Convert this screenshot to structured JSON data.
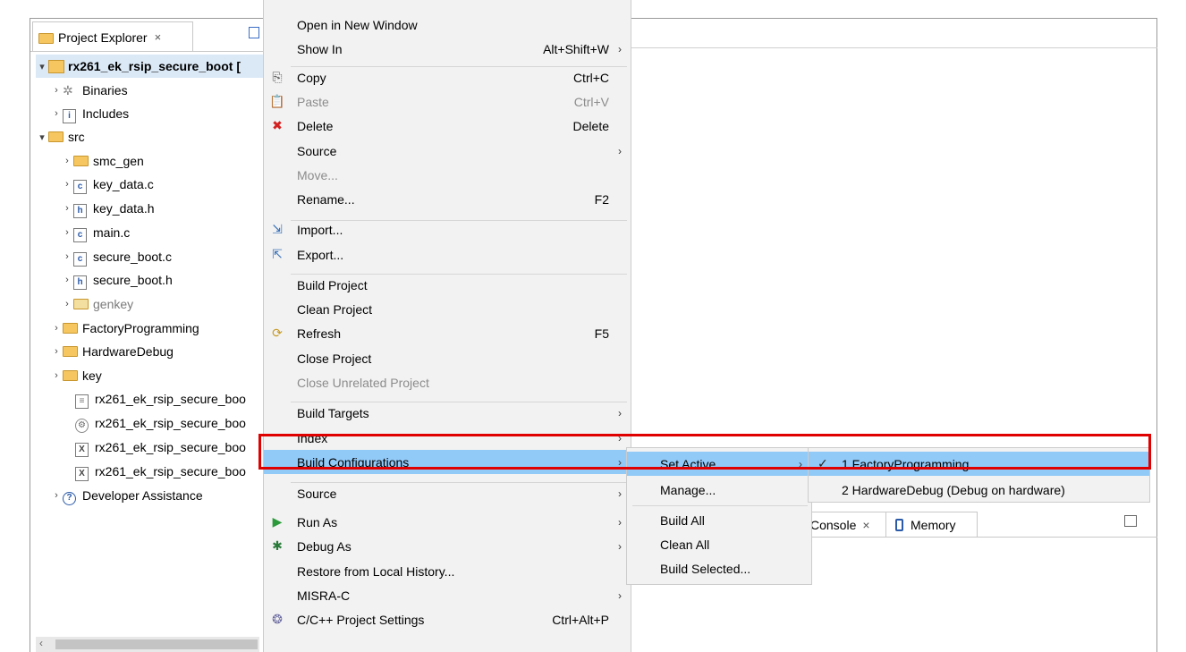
{
  "explorer": {
    "tab_label": "Project Explorer",
    "tab_close": "×",
    "items": [
      {
        "label": "rx261_ek_rsip_secure_boot [",
        "chevron": "▾",
        "icon": "project-icon"
      },
      {
        "label": "Binaries",
        "chevron": "›",
        "icon": "binaries-icon"
      },
      {
        "label": "Includes",
        "chevron": "›",
        "icon": "includes-icon"
      },
      {
        "label": "src",
        "chevron": "▾",
        "icon": "source-folder-icon"
      },
      {
        "label": "smc_gen",
        "chevron": "›",
        "icon": "folder-icon"
      },
      {
        "label": "key_data.c",
        "chevron": "›",
        "icon": "c-file-icon"
      },
      {
        "label": "key_data.h",
        "chevron": "›",
        "icon": "h-file-icon"
      },
      {
        "label": "main.c",
        "chevron": "›",
        "icon": "c-file-icon"
      },
      {
        "label": "secure_boot.c",
        "chevron": "›",
        "icon": "c-file-icon"
      },
      {
        "label": "secure_boot.h",
        "chevron": "›",
        "icon": "h-file-icon"
      },
      {
        "label": "genkey",
        "chevron": "›",
        "icon": "excluded-folder-icon"
      },
      {
        "label": "FactoryProgramming",
        "chevron": "›",
        "icon": "folder-icon"
      },
      {
        "label": "HardwareDebug",
        "chevron": "›",
        "icon": "folder-icon"
      },
      {
        "label": "key",
        "chevron": "›",
        "icon": "folder-icon"
      },
      {
        "label": "rx261_ek_rsip_secure_boo",
        "chevron": "",
        "icon": "document-icon"
      },
      {
        "label": "rx261_ek_rsip_secure_boo",
        "chevron": "",
        "icon": "gear-file-icon"
      },
      {
        "label": "rx261_ek_rsip_secure_boo",
        "chevron": "",
        "icon": "xml-file-icon"
      },
      {
        "label": "rx261_ek_rsip_secure_boo",
        "chevron": "",
        "icon": "xml-file-icon"
      },
      {
        "label": "Developer Assistance",
        "chevron": "›",
        "icon": "help-icon"
      }
    ],
    "scroll_left": "‹"
  },
  "context_menu": {
    "items": [
      {
        "label": "Open in New Window",
        "accel": "",
        "sub": false,
        "disabled": false
      },
      {
        "label": "Show In",
        "accel": "Alt+Shift+W",
        "sub": true,
        "disabled": false
      },
      {
        "label": "Copy",
        "accel": "Ctrl+C",
        "sub": false,
        "disabled": false
      },
      {
        "label": "Paste",
        "accel": "Ctrl+V",
        "sub": false,
        "disabled": true
      },
      {
        "label": "Delete",
        "accel": "Delete",
        "sub": false,
        "disabled": false
      },
      {
        "label": "Source",
        "accel": "",
        "sub": true,
        "disabled": false
      },
      {
        "label": "Move...",
        "accel": "",
        "sub": false,
        "disabled": true
      },
      {
        "label": "Rename...",
        "accel": "F2",
        "sub": false,
        "disabled": false
      },
      {
        "label": "Import...",
        "accel": "",
        "sub": false,
        "disabled": false
      },
      {
        "label": "Export...",
        "accel": "",
        "sub": false,
        "disabled": false
      },
      {
        "label": "Build Project",
        "accel": "",
        "sub": false,
        "disabled": false
      },
      {
        "label": "Clean Project",
        "accel": "",
        "sub": false,
        "disabled": false
      },
      {
        "label": "Refresh",
        "accel": "F5",
        "sub": false,
        "disabled": false
      },
      {
        "label": "Close Project",
        "accel": "",
        "sub": false,
        "disabled": false
      },
      {
        "label": "Close Unrelated Project",
        "accel": "",
        "sub": false,
        "disabled": true
      },
      {
        "label": "Build Targets",
        "accel": "",
        "sub": true,
        "disabled": false
      },
      {
        "label": "Index",
        "accel": "",
        "sub": true,
        "disabled": false
      },
      {
        "label": "Build Configurations",
        "accel": "",
        "sub": true,
        "disabled": false
      },
      {
        "label": "Source",
        "accel": "",
        "sub": true,
        "disabled": false
      },
      {
        "label": "Run As",
        "accel": "",
        "sub": true,
        "disabled": false
      },
      {
        "label": "Debug As",
        "accel": "",
        "sub": true,
        "disabled": false
      },
      {
        "label": "Restore from Local History...",
        "accel": "",
        "sub": false,
        "disabled": false
      },
      {
        "label": "MISRA-C",
        "accel": "",
        "sub": true,
        "disabled": false
      },
      {
        "label": "C/C++ Project Settings",
        "accel": "Ctrl+Alt+P",
        "sub": false,
        "disabled": false
      }
    ],
    "submenu_arrow": "›"
  },
  "build_config_menu": {
    "items": [
      "Set Active",
      "Manage...",
      "Build All",
      "Clean All",
      "Build Selected..."
    ]
  },
  "set_active_menu": {
    "items": [
      "1 FactoryProgramming",
      "2 HardwareDebug (Debug on hardware)"
    ],
    "checked": "✓"
  },
  "console": {
    "console_tab": "Console",
    "console_close": "×",
    "memory_tab": "Memory"
  },
  "colors": {
    "highlight": "#91c9f7",
    "annotation_red": "#e00000",
    "menu_bg": "#f2f2f2"
  }
}
